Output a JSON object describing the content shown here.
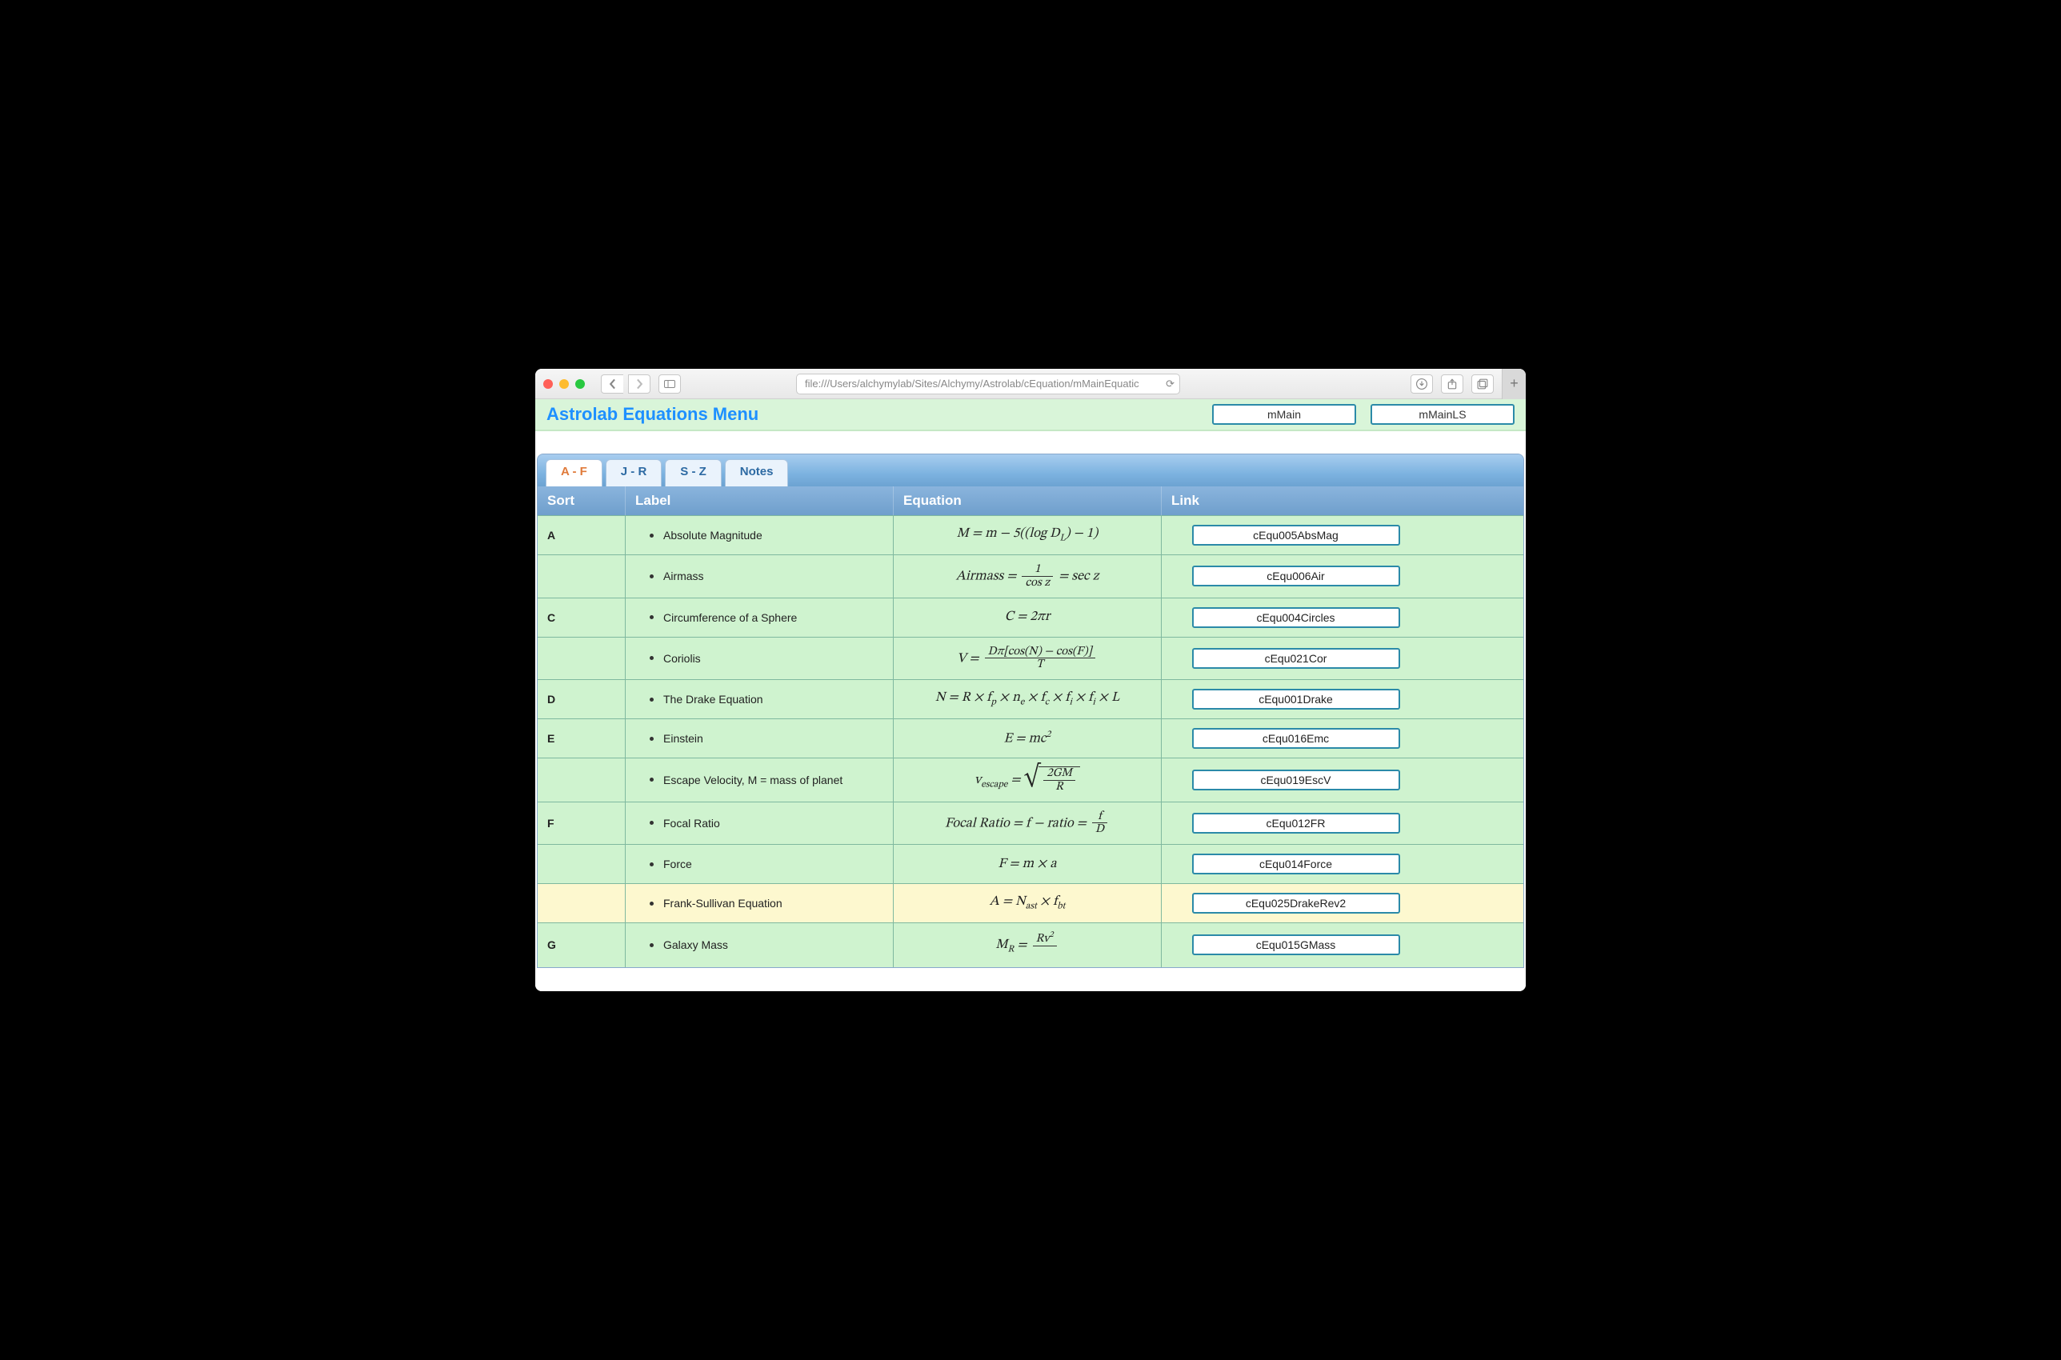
{
  "browser": {
    "url": "file:///Users/alchymylab/Sites/Alchymy/Astrolab/cEquation/mMainEquatic"
  },
  "header": {
    "title": "Astrolab Equations Menu",
    "buttons": [
      "mMain",
      "mMainLS"
    ]
  },
  "tabs": [
    "A - F",
    "J - R",
    "S - Z",
    "Notes"
  ],
  "active_tab": "A - F",
  "columns": [
    "Sort",
    "Label",
    "Equation",
    "Link"
  ],
  "rows": [
    {
      "sort": "A",
      "label": "Absolute Magnitude",
      "eq_key": "absmag",
      "link": "cEqu005AbsMag",
      "alt": false
    },
    {
      "sort": "",
      "label": "Airmass",
      "eq_key": "airmass",
      "link": "cEqu006Air",
      "alt": false
    },
    {
      "sort": "C",
      "label": "Circumference of a Sphere",
      "eq_key": "circ",
      "link": "cEqu004Circles",
      "alt": false
    },
    {
      "sort": "",
      "label": "Coriolis",
      "eq_key": "coriolis",
      "link": "cEqu021Cor",
      "alt": false
    },
    {
      "sort": "D",
      "label": "The Drake Equation",
      "eq_key": "drake",
      "link": "cEqu001Drake",
      "alt": false
    },
    {
      "sort": "E",
      "label": "Einstein",
      "eq_key": "emc",
      "link": "cEqu016Emc",
      "alt": false
    },
    {
      "sort": "",
      "label": "Escape Velocity, M = mass of planet",
      "eq_key": "escv",
      "link": "cEqu019EscV",
      "alt": false
    },
    {
      "sort": "F",
      "label": "Focal Ratio",
      "eq_key": "focal",
      "link": "cEqu012FR",
      "alt": false
    },
    {
      "sort": "",
      "label": "Force",
      "eq_key": "force",
      "link": "cEqu014Force",
      "alt": false
    },
    {
      "sort": "",
      "label": "Frank-Sullivan Equation",
      "eq_key": "franksull",
      "link": "cEqu025DrakeRev2",
      "alt": true
    },
    {
      "sort": "G",
      "label": "Galaxy Mass",
      "eq_key": "gmass",
      "link": "cEqu015GMass",
      "alt": false
    }
  ]
}
